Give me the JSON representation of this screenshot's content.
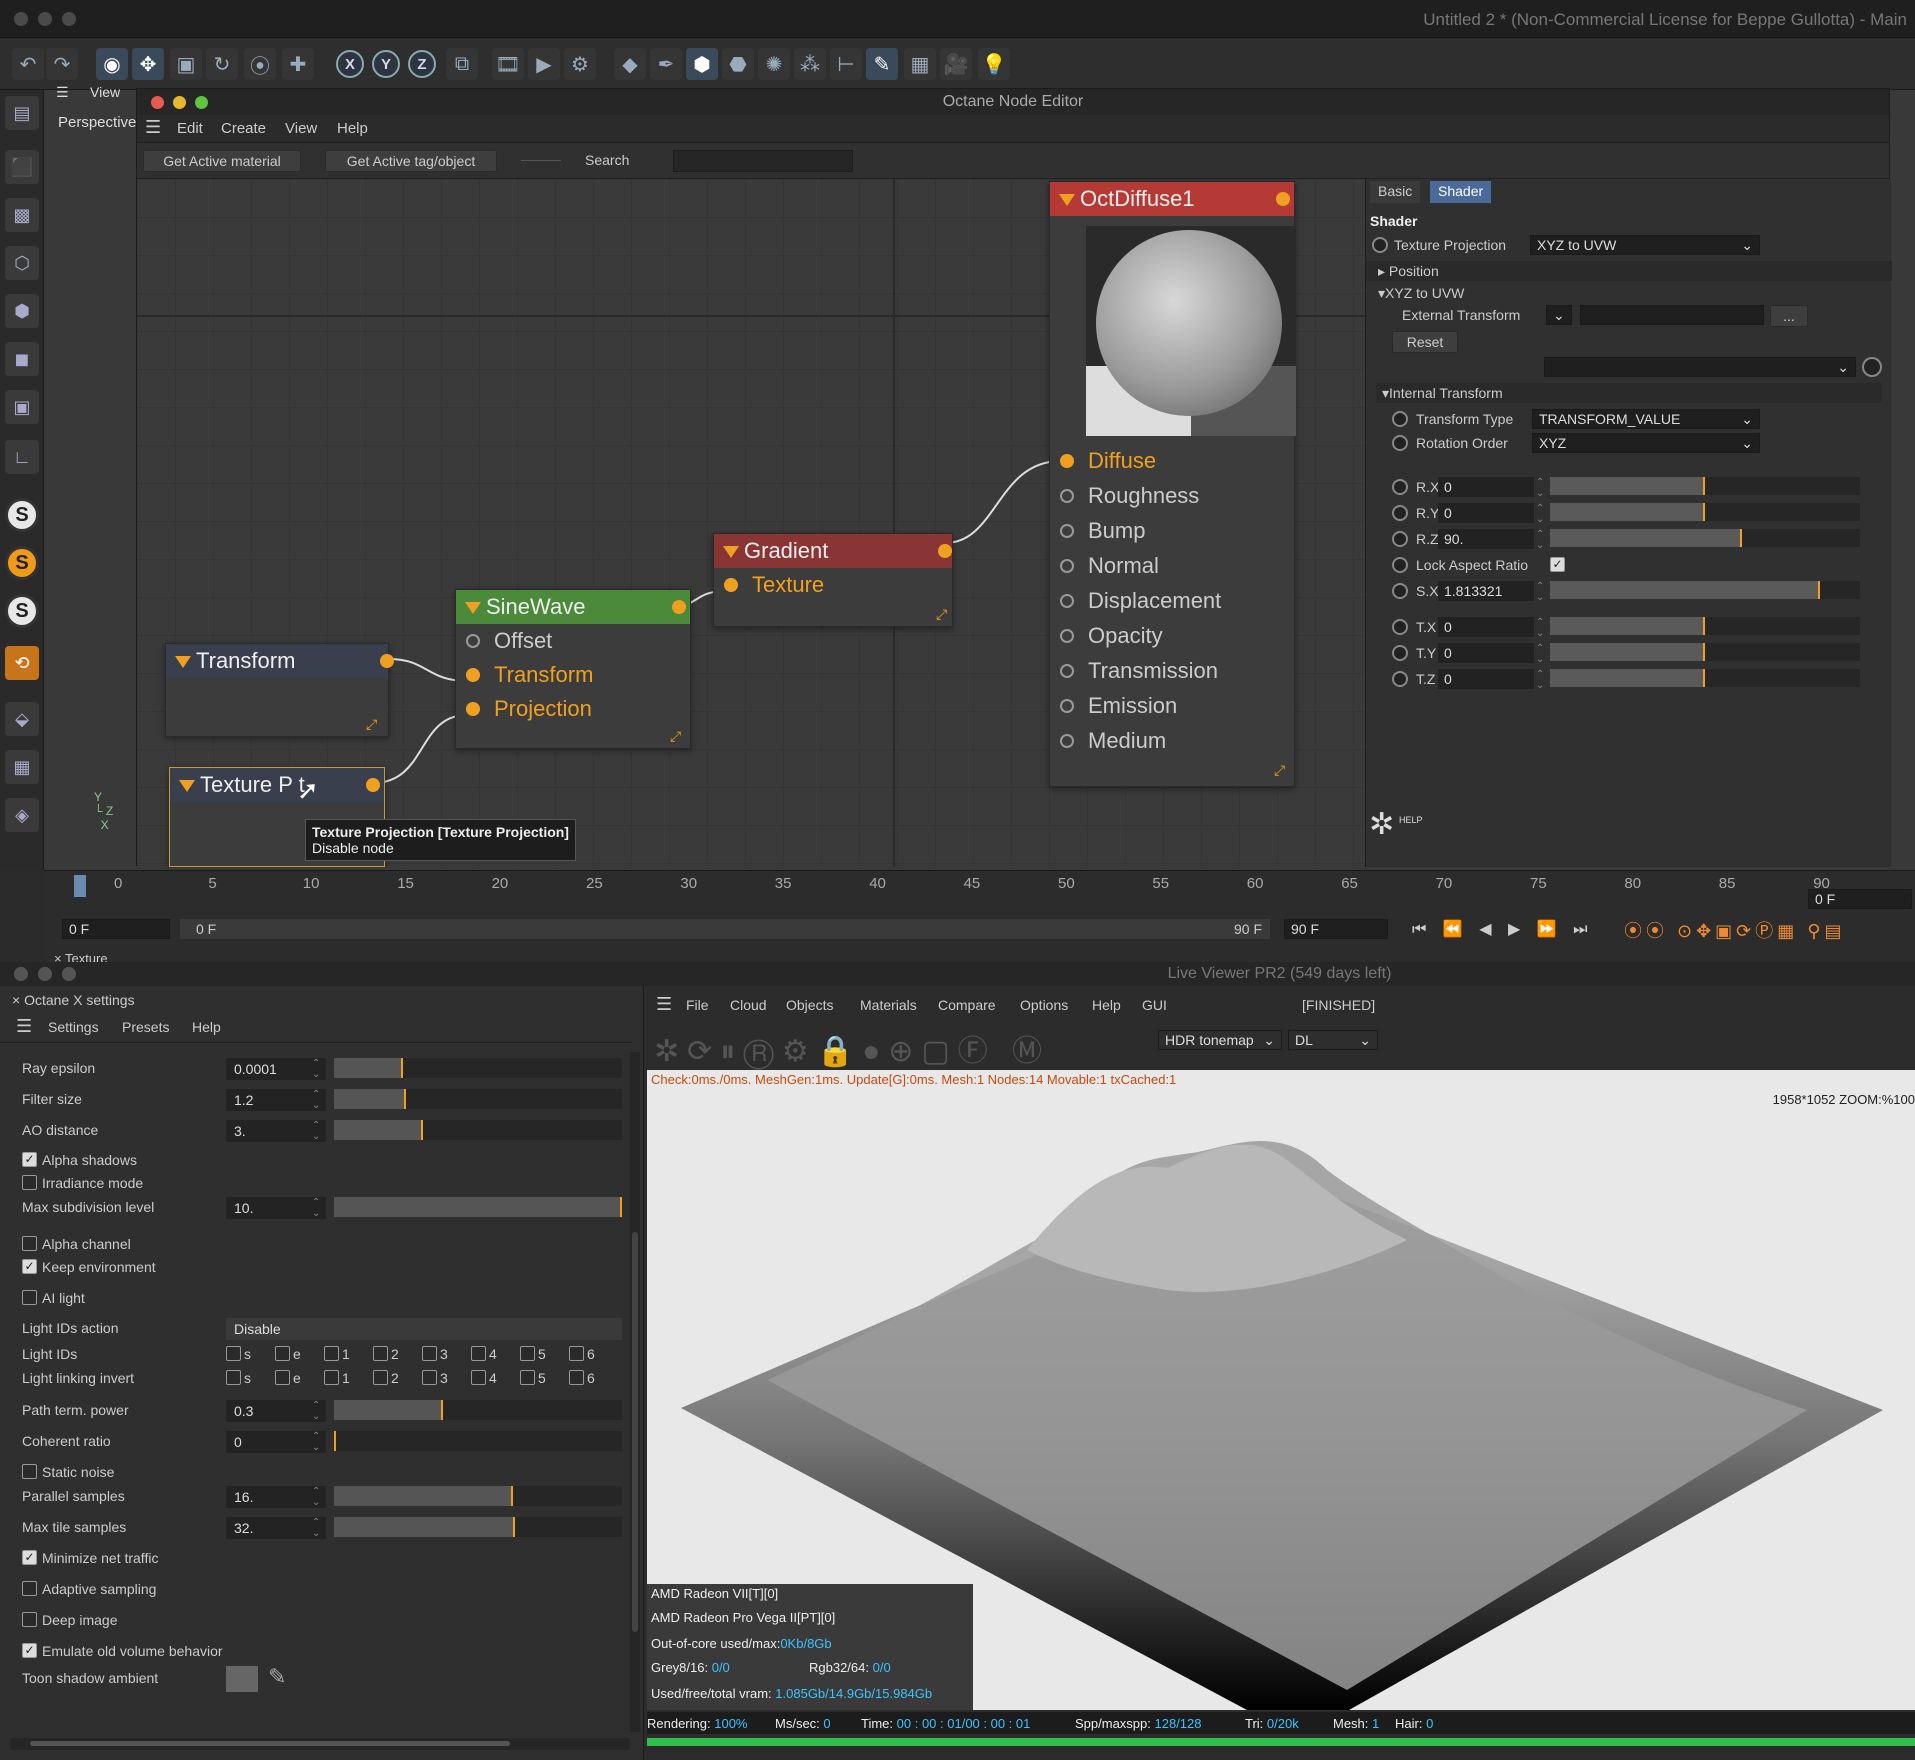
{
  "app": {
    "title": "Untitled 2 * (Non-Commercial License for Beppe Gullotta) - Main"
  },
  "viewport": {
    "label": "View",
    "camera": "Perspective"
  },
  "node_editor": {
    "title": "Octane Node Editor",
    "menu": [
      "Edit",
      "Create",
      "View",
      "Help"
    ],
    "buttons": {
      "active_material": "Get Active material",
      "active_tag": "Get Active tag/object",
      "search_label": "Search",
      "search_placeholder": ""
    },
    "nodes": {
      "transform": {
        "title": "Transform"
      },
      "texture_projection": {
        "title": "Texture P   t"
      },
      "sinewave": {
        "title": "SineWave",
        "ports": [
          "Offset",
          "Transform",
          "Projection"
        ]
      },
      "gradient": {
        "title": "Gradient",
        "ports": [
          "Texture"
        ]
      },
      "octdiffuse": {
        "title": "OctDiffuse1",
        "ports": [
          "Diffuse",
          "Roughness",
          "Bump",
          "Normal",
          "Displacement",
          "Opacity",
          "Transmission",
          "Emission",
          "Medium"
        ]
      }
    },
    "tooltip": {
      "line1": "Texture Projection [Texture Projection]",
      "line2": "Disable node"
    },
    "colors": {
      "gradient_header": "#8a3535",
      "sinewave_header": "#4a8a3a",
      "octdiffuse_header": "#b53a35",
      "port": "#f0a020"
    }
  },
  "attributes": {
    "tabs": [
      "Basic",
      "Shader"
    ],
    "section": "Shader",
    "texture_projection_label": "Texture Projection",
    "texture_projection_value": "XYZ to UVW",
    "position": "Position",
    "xyz_group": "XYZ to UVW",
    "external_transform": "External Transform",
    "dots": "...",
    "reset": "Reset",
    "internal_transform": "Internal Transform",
    "transform_type_label": "Transform Type",
    "transform_type_value": "TRANSFORM_VALUE",
    "rotation_order_label": "Rotation Order",
    "rotation_order_value": "XYZ",
    "rx": {
      "label": "R.X",
      "value": "0",
      "fill": 0.5
    },
    "ry": {
      "label": "R.Y",
      "value": "0",
      "fill": 0.5
    },
    "rz": {
      "label": "R.Z",
      "value": "90.",
      "fill": 0.62
    },
    "lock_aspect": "Lock Aspect Ratio",
    "sx": {
      "label": "S.X",
      "value": "1.813321",
      "fill": 0.87
    },
    "tx": {
      "label": "T.X",
      "value": "0",
      "fill": 0.5
    },
    "ty": {
      "label": "T.Y",
      "value": "0",
      "fill": 0.5
    },
    "tz": {
      "label": "T.Z",
      "value": "0",
      "fill": 0.5
    },
    "help": "HELP"
  },
  "timeline": {
    "ticks": [
      "0",
      "5",
      "10",
      "15",
      "20",
      "25",
      "30",
      "35",
      "40",
      "45",
      "50",
      "55",
      "60",
      "65",
      "70",
      "75",
      "80",
      "85",
      "90"
    ],
    "frame_right": "0 F",
    "start": "0 F",
    "current": "0 F",
    "end": "90 F",
    "end2": "90 F",
    "texture_tab": "Texture"
  },
  "settings": {
    "title": "Octane X settings",
    "menu": [
      "Settings",
      "Presets",
      "Help"
    ],
    "ray_epsilon": {
      "label": "Ray epsilon",
      "value": "0.0001",
      "fill": 0.24
    },
    "filter_size": {
      "label": "Filter size",
      "value": "1.2",
      "fill": 0.25
    },
    "ao_distance": {
      "label": "AO distance",
      "value": "3.",
      "fill": 0.31
    },
    "alpha_shadows": "Alpha shadows",
    "irradiance_mode": "Irradiance mode",
    "max_subdiv": {
      "label": "Max subdivision level",
      "value": "10.",
      "fill": 1.0
    },
    "alpha_channel": "Alpha channel",
    "keep_env": "Keep environment",
    "ai_light": "AI light",
    "light_ids_action_label": "Light IDs action",
    "light_ids_action_value": "Disable",
    "light_ids": "Light IDs",
    "light_linking_invert": "Light linking invert",
    "id_labels": [
      "s",
      "e",
      "1",
      "2",
      "3",
      "4",
      "5",
      "6"
    ],
    "path_term": {
      "label": "Path term. power",
      "value": "0.3",
      "fill": 0.38
    },
    "coherent": {
      "label": "Coherent ratio",
      "value": "0",
      "fill": 0.0
    },
    "static_noise": "Static noise",
    "parallel": {
      "label": "Parallel samples",
      "value": "16.",
      "fill": 0.62
    },
    "max_tile": {
      "label": "Max tile samples",
      "value": "32.",
      "fill": 0.63
    },
    "minimize_net": "Minimize net traffic",
    "adaptive": "Adaptive sampling",
    "deep_image": "Deep image",
    "emulate_old": "Emulate old volume behavior",
    "toon_shadow": "Toon shadow ambient"
  },
  "live_viewer": {
    "title": "Live Viewer PR2 (549 days left)",
    "menu": [
      "File",
      "Cloud",
      "Objects",
      "Materials",
      "Compare",
      "Options",
      "Help",
      "GUI"
    ],
    "status": "[FINISHED]",
    "tonemap": "HDR tonemap",
    "mode": "DL",
    "check": "Check:0ms./0ms. MeshGen:1ms. Update[G]:0ms. Mesh:1 Nodes:14 Movable:1 txCached:1",
    "zoom": "1958*1052 ZOOM:%100",
    "gpu1": "AMD Radeon VII[T][0]",
    "gpu2": "AMD Radeon Pro Vega II[PT][0]",
    "ooc_label": "Out-of-core used/max:",
    "ooc_value": "0Kb/8Gb",
    "grey_label": "Grey8/16:",
    "grey_value": "0/0",
    "rgb_label": "Rgb32/64:",
    "rgb_value": "0/0",
    "vram_label": "Used/free/total vram:",
    "vram_value": "1.085Gb/14.9Gb/15.984Gb",
    "rendering_label": "Rendering:",
    "rendering_value": "100%",
    "mssec_label": "Ms/sec:",
    "mssec_value": "0",
    "time_label": "Time:",
    "time_value": "00 : 00 : 01/00 : 00 : 01",
    "spp_label": "Spp/maxspp:",
    "spp_value": "128/128",
    "tri_label": "Tri:",
    "tri_value": "0/20k",
    "mesh_label": "Mesh:",
    "mesh_value": "1",
    "hair_label": "Hair:",
    "hair_value": "0",
    "progress": 1.0
  }
}
